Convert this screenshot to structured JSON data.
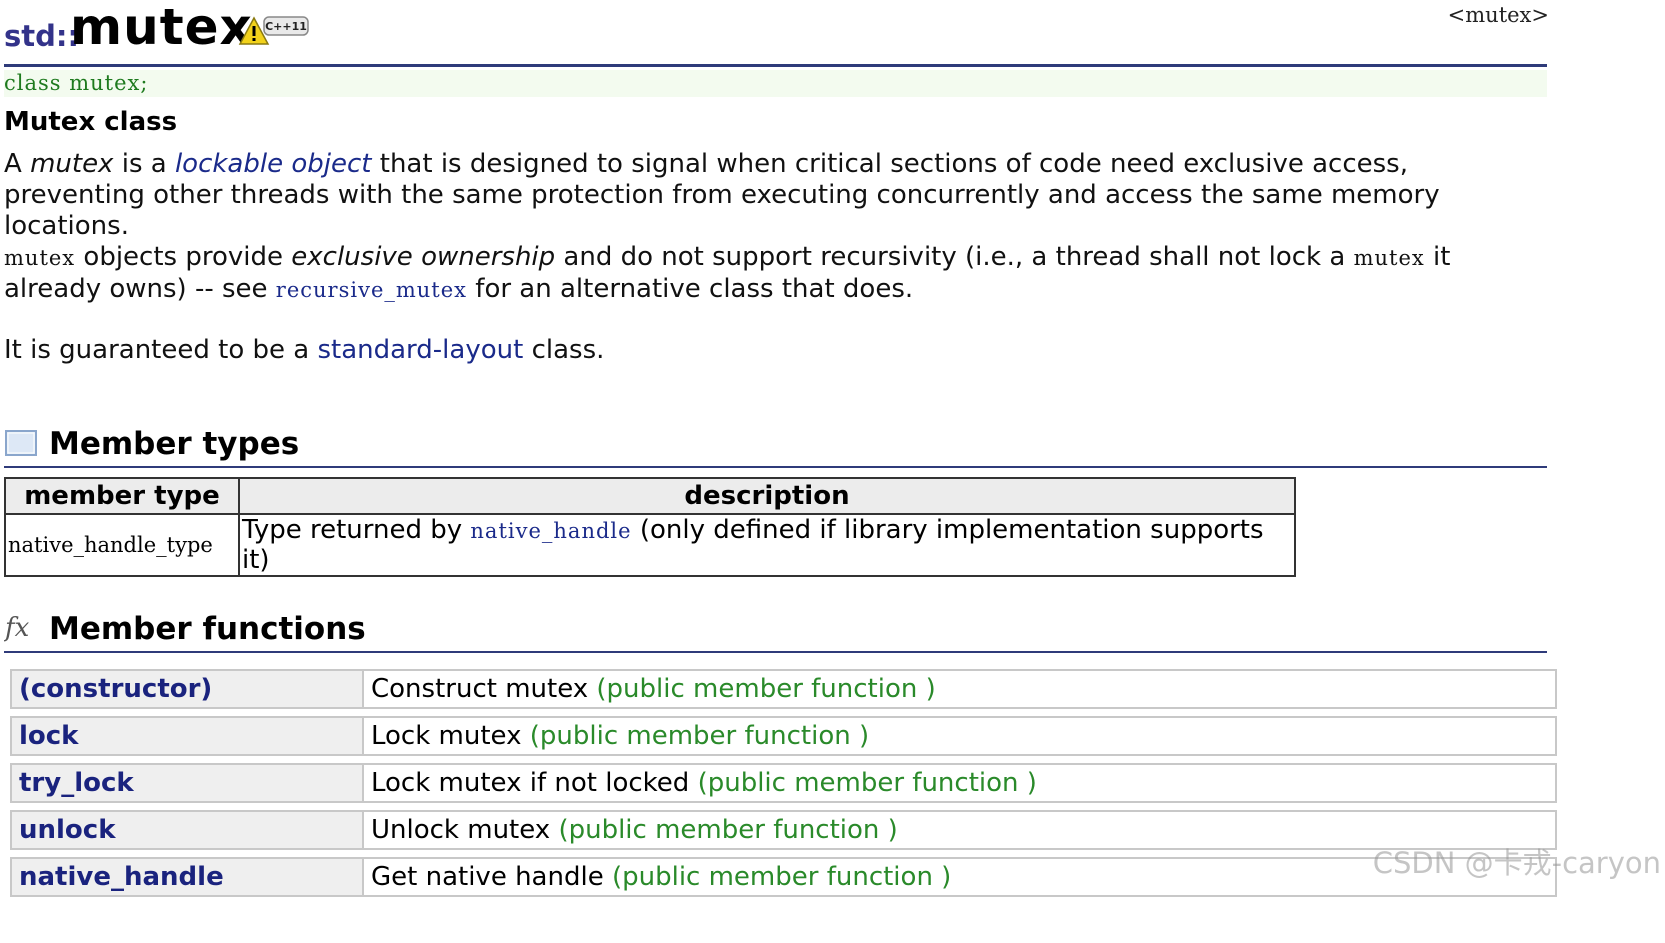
{
  "header": {
    "namespace": "std::",
    "name": "mutex",
    "badge": "C++11",
    "header_file": "<mutex>"
  },
  "declaration": "class mutex;",
  "subtitle": "Mutex class",
  "para1": {
    "a": "A ",
    "mutex_italic": "mutex",
    "is_a": " is a ",
    "lockable_link": "lockable object",
    "rest": " that is designed to signal when critical sections of code need exclusive access, preventing other threads with the same protection from executing concurrently and access the same memory locations."
  },
  "para2": {
    "mutex_code": "mutex",
    "objects_provide": " objects provide ",
    "exclusive_ownership": "exclusive ownership",
    "and_do_not": " and do not support recursivity (i.e., a thread shall not lock a ",
    "mutex_code2": "mutex",
    "it_already": " it already owns) -- see ",
    "recursive_link": "recursive_mutex",
    "for_alt": " for an alternative class that does."
  },
  "para3": {
    "it_is": "It is guaranteed to be a ",
    "standard_layout_link": "standard-layout",
    "class_end": " class."
  },
  "member_types": {
    "title": "Member types",
    "headers": [
      "member type",
      "description"
    ],
    "rows": [
      {
        "type": "native_handle_type",
        "desc_pre": "Type returned by ",
        "desc_link": "native_handle",
        "desc_post": " (only defined if library implementation supports it)"
      }
    ]
  },
  "member_functions": {
    "title": "Member functions",
    "icon_glyph": "fx",
    "rows": [
      {
        "name": "(constructor)",
        "desc": "Construct mutex ",
        "kind": "(public member function )"
      },
      {
        "name": "lock",
        "desc": "Lock mutex ",
        "kind": "(public member function )"
      },
      {
        "name": "try_lock",
        "desc": "Lock mutex if not locked ",
        "kind": "(public member function )"
      },
      {
        "name": "unlock",
        "desc": "Unlock mutex ",
        "kind": "(public member function )"
      },
      {
        "name": "native_handle",
        "desc": "Get native handle ",
        "kind": "(public member function )"
      }
    ]
  },
  "watermark": "CSDN @卡戎-caryon"
}
